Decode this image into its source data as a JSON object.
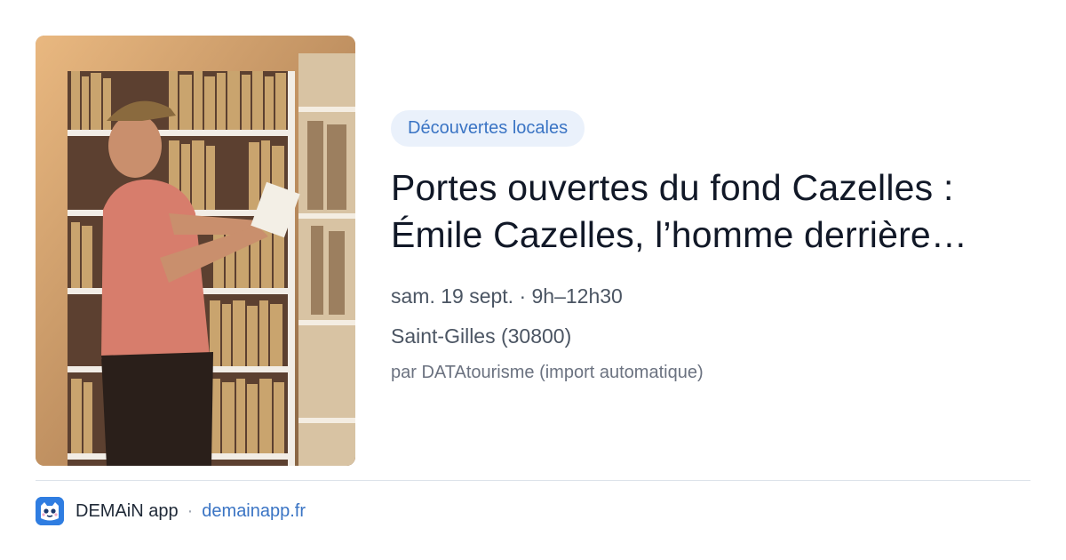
{
  "event": {
    "image_alt": "Homme consultant un ouvrage devant des étagères d'archives",
    "category": "Découvertes locales",
    "title": "Portes ouvertes du fond Cazelles : Émile Cazelles, l’homme derrière…",
    "datetime": "sam. 19 sept. · 9h–12h30",
    "location": "Saint-Gilles (30800)",
    "source": "par DATAtourisme (import automatique)"
  },
  "footer": {
    "logo_icon": "demain-logo-icon",
    "app_name": "DEMAiN app",
    "separator": "·",
    "url": "demainapp.fr"
  },
  "colors": {
    "accent": "#3a74c4",
    "tag_bg": "#eaf1fb",
    "logo_bg": "#2f7de1"
  }
}
